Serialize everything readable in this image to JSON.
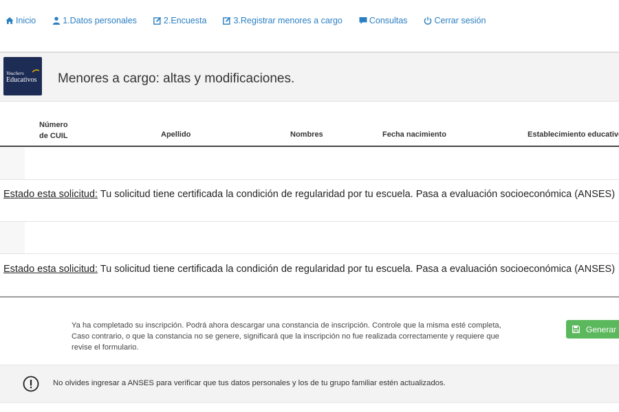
{
  "nav": {
    "items": [
      {
        "label": "Inicio",
        "icon": "home-icon"
      },
      {
        "label": "1.Datos personales",
        "icon": "user-icon"
      },
      {
        "label": "2.Encuesta",
        "icon": "edit-icon"
      },
      {
        "label": "3.Registrar menores a cargo",
        "icon": "edit-icon"
      },
      {
        "label": "Consultas",
        "icon": "comment-icon"
      },
      {
        "label": "Cerrar sesión",
        "icon": "power-icon"
      }
    ],
    "color": "#2a7fc1"
  },
  "header": {
    "title": "Menores a cargo: altas y modificaciones.",
    "logo_line1": "Vouchers",
    "logo_line2": "Educativos"
  },
  "table": {
    "columns": [
      "Número de CUIL",
      "Apellido",
      "Nombres",
      "Fecha nacimiento",
      "Establecimiento educativo"
    ],
    "cuil_line1": "Número",
    "cuil_line2": "de CUIL",
    "status_rows": [
      {
        "label": "Estado esta solicitud:",
        "text": " Tu solicitud tiene certificada la condición de regularidad por tu escuela. Pasa a evaluación socioeconómica (ANSES)"
      },
      {
        "label": "Estado esta solicitud:",
        "text": " Tu solicitud tiene certificada la condición de regularidad por tu escuela. Pasa a evaluación socioeconómica (ANSES)"
      }
    ]
  },
  "footer": {
    "completed_text": "Ya ha completado su inscripción. Podrá ahora descargar una constancia de inscripción. Controle que la misma esté completa, Caso contrario, o que la constancia no se genere, significará que la inscripción no fue realizada correctamente y requiere que revise el formulario.",
    "generate_label": "Generar c",
    "generate_color": "#5cb85c",
    "notice_text": "No olvides ingresar a ANSES para verificar que tus datos personales y los de tu grupo familiar estén actualizados."
  }
}
